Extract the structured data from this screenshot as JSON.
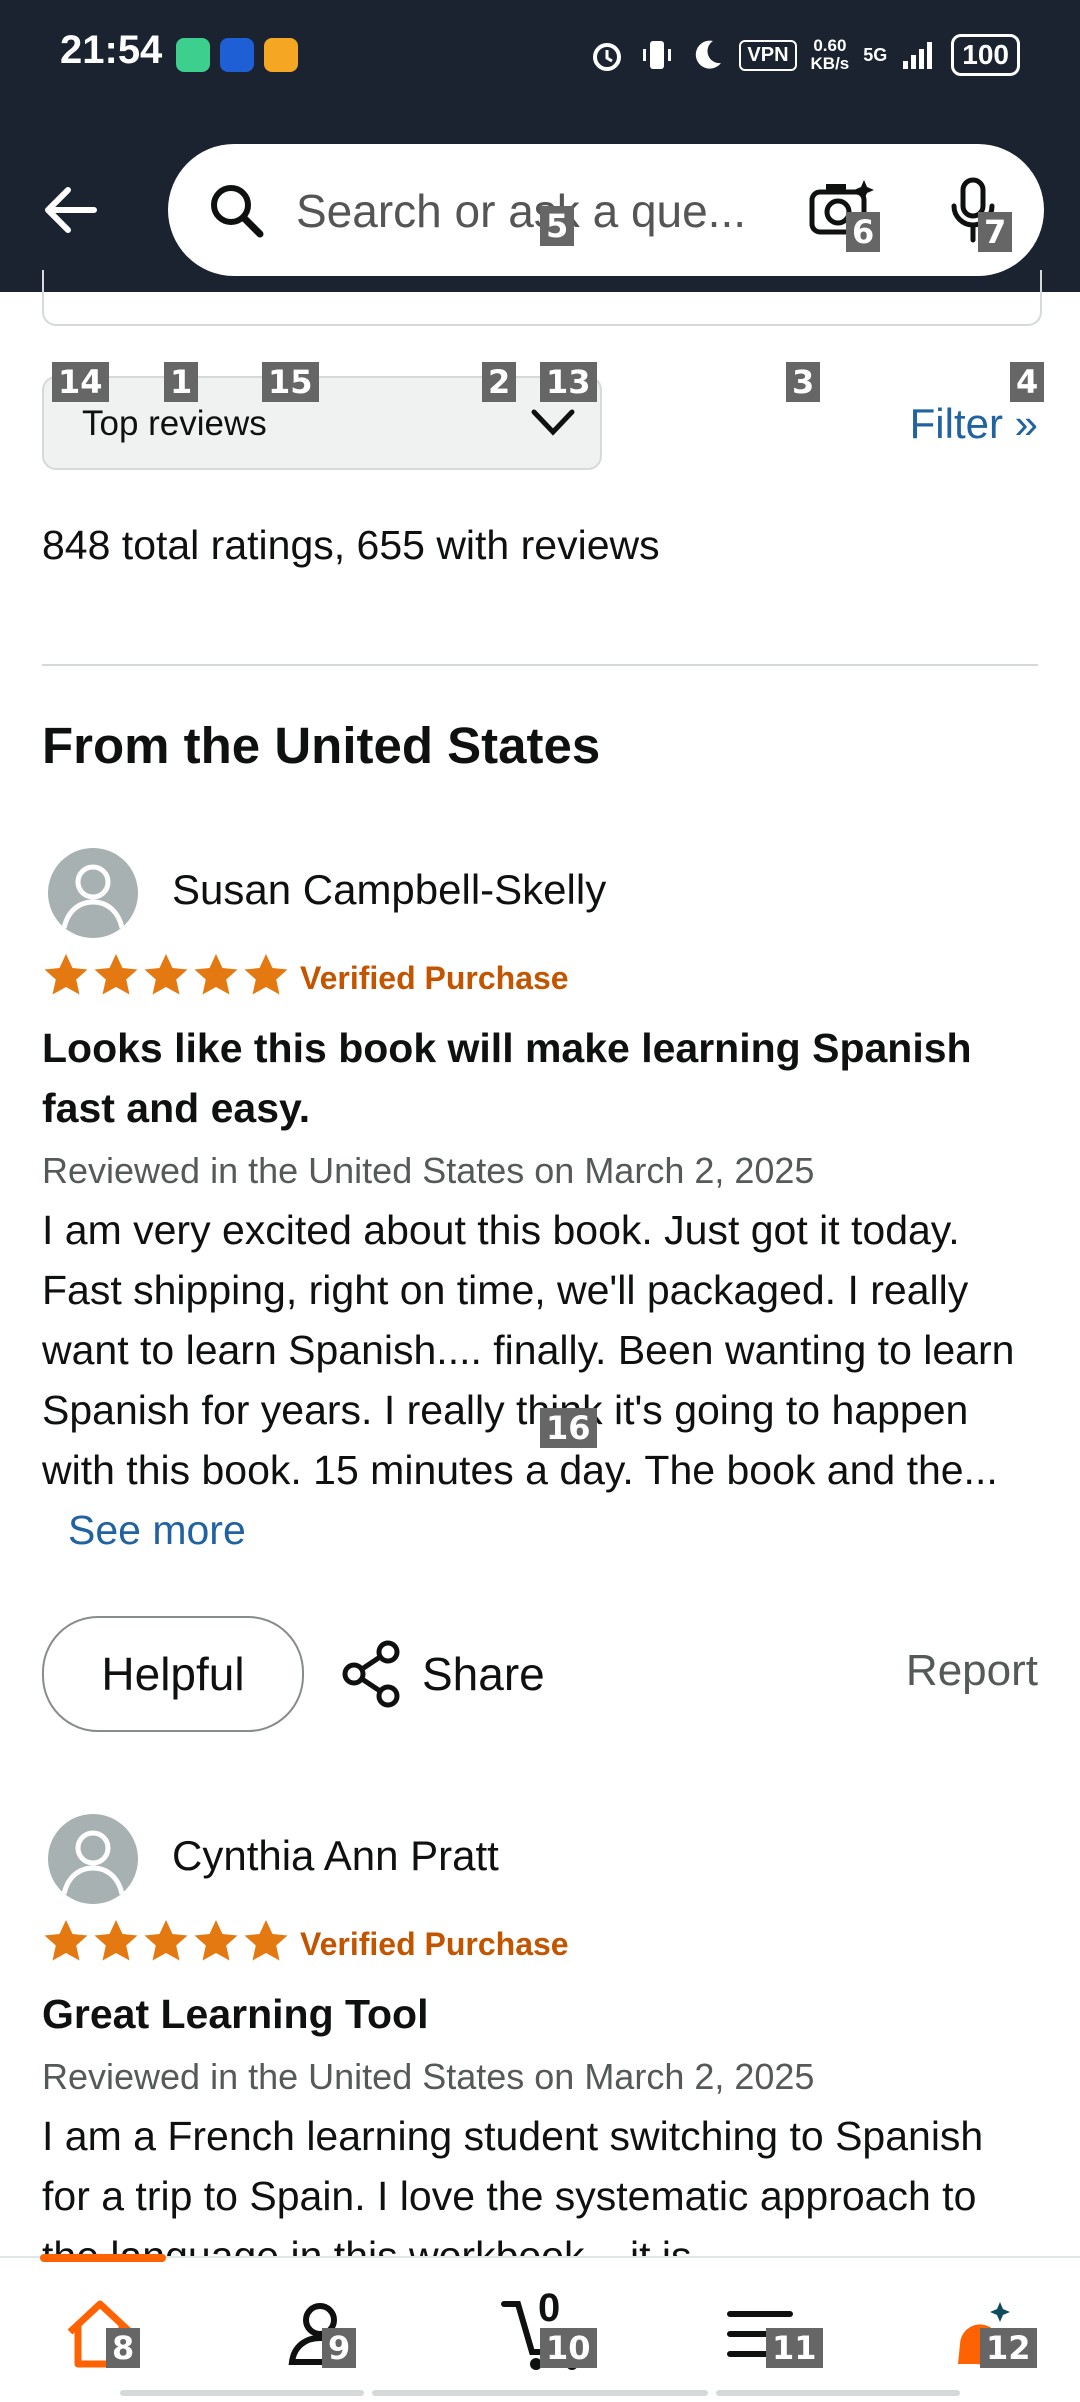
{
  "status_bar": {
    "time": "21:54",
    "vpn": "VPN",
    "speed_value": "0.60",
    "speed_unit": "KB/s",
    "network": "5G",
    "battery": "100",
    "icons": [
      "app-green-icon",
      "app-blue-icon",
      "app-yellow-icon",
      "alarm-icon",
      "vibrate-icon",
      "moon-icon",
      "signal-icon"
    ]
  },
  "header": {
    "search_placeholder": "Search or ask a que...",
    "icons": [
      "back-arrow-icon",
      "search-icon",
      "camera-icon",
      "microphone-icon"
    ]
  },
  "controls": {
    "sort_label": "Top reviews",
    "filter_label": "Filter »"
  },
  "summary": {
    "total_text": "848 total ratings, 655 with reviews",
    "section_title": "From the United States"
  },
  "reviews": [
    {
      "name": "Susan Campbell-Skelly",
      "stars": 5,
      "verified": "Verified Purchase",
      "title": "Looks like this book will make learning Spanish fast and easy.",
      "meta": "Reviewed in the United States on March 2, 2025",
      "body": "I am very excited about this book. Just got it today. Fast shipping, right on time, we'll packaged. I really want to learn Spanish.... finally. Been wanting to learn Spanish for years. I really think it's going to happen with this book. 15 minutes a day. The book and the...",
      "see_more": "See more",
      "helpful": "Helpful",
      "share": "Share",
      "report": "Report"
    },
    {
      "name": "Cynthia Ann Pratt",
      "stars": 5,
      "verified": "Verified Purchase",
      "title": "Great Learning Tool",
      "meta": "Reviewed in the United States on March 2, 2025",
      "body": "I am a French learning student switching to Spanish for a trip to Spain. I love the systematic approach to the language in this workbook... it is"
    }
  ],
  "bottom_nav": {
    "cart_count": "0",
    "items": [
      "home-icon",
      "account-icon",
      "cart-icon",
      "menu-icon",
      "rufus-icon"
    ]
  },
  "colors": {
    "header_bg": "#1b2330",
    "star": "#e47911",
    "verified": "#c45500",
    "link": "#2162a1",
    "accent": "#ff6200"
  },
  "markers": [
    "1",
    "2",
    "3",
    "4",
    "5",
    "6",
    "7",
    "8",
    "9",
    "10",
    "11",
    "12",
    "13",
    "14",
    "15",
    "16"
  ]
}
